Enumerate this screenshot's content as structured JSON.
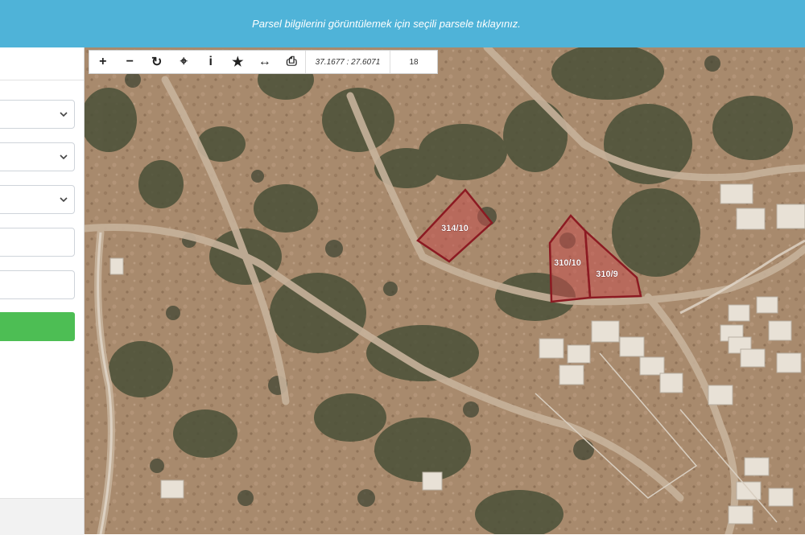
{
  "banner": {
    "text": "Parsel bilgilerini görüntülemek için seçili parsele tıklayınız."
  },
  "toolbar": {
    "buttons": [
      {
        "icon": "zoom-in-icon",
        "glyph": "+"
      },
      {
        "icon": "zoom-out-icon",
        "glyph": "−"
      },
      {
        "icon": "refresh-icon",
        "glyph": "↻"
      },
      {
        "icon": "locate-icon",
        "glyph": "⌖"
      },
      {
        "icon": "info-icon",
        "glyph": "i"
      },
      {
        "icon": "star-icon",
        "glyph": "★"
      },
      {
        "icon": "measure-icon",
        "glyph": "↔"
      },
      {
        "icon": "print-icon",
        "glyph": "⎙"
      }
    ],
    "coordinates": "37.1677 : 27.6071",
    "zoom_level": "18"
  },
  "parcels": [
    {
      "label": "314/10"
    },
    {
      "label": "310/10"
    },
    {
      "label": "310/9"
    }
  ],
  "colors": {
    "banner": "#4fb3d8",
    "submit": "#4dbe54",
    "parcel_fill": "#c4504f",
    "parcel_stroke": "#8c1a22"
  }
}
